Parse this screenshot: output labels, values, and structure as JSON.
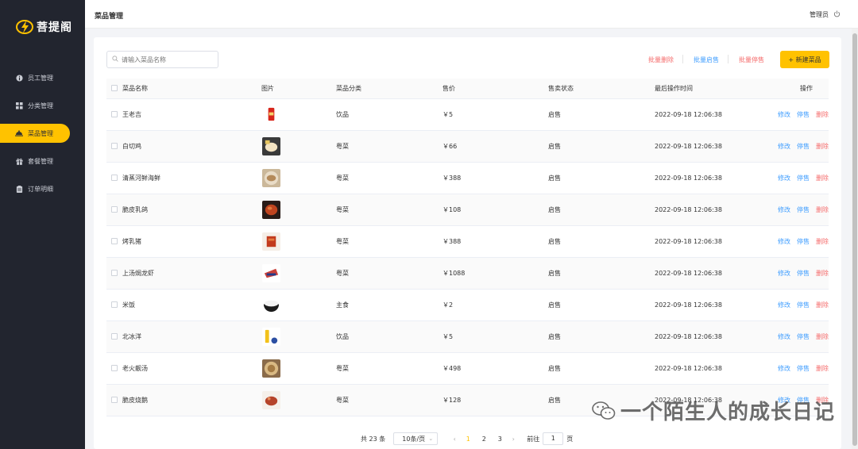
{
  "sidebar": {
    "brand": "菩提阁",
    "items": [
      {
        "label": "员工管理",
        "icon": "info-circle-icon",
        "active": false
      },
      {
        "label": "分类管理",
        "icon": "grid-icon",
        "active": false
      },
      {
        "label": "菜品管理",
        "icon": "dish-cover-icon",
        "active": true
      },
      {
        "label": "套餐管理",
        "icon": "gift-box-icon",
        "active": false
      },
      {
        "label": "订单明细",
        "icon": "clipboard-icon",
        "active": false
      }
    ]
  },
  "header": {
    "title": "菜品管理",
    "user": "管理员",
    "logout_icon": "power-icon"
  },
  "toolbar": {
    "search_placeholder": "请输入菜品名称",
    "batch_delete": "批量删除",
    "batch_enable": "批量启售",
    "batch_disable": "批量停售",
    "new_dish": "+ 新建菜品"
  },
  "table": {
    "headers": {
      "name": "菜品名称",
      "image": "图片",
      "category": "菜品分类",
      "price": "售价",
      "status": "售卖状态",
      "time": "最后操作时间",
      "ops": "操作"
    },
    "rows": [
      {
        "name": "王老吉",
        "image_icon": "red-can-icon",
        "category": "饮品",
        "price": "￥5",
        "status": "启售",
        "time": "2022-09-18 12:06:38",
        "edit": "修改",
        "toggle": "停售",
        "delete": "删除"
      },
      {
        "name": "白切鸡",
        "image_icon": "chicken-dish-icon",
        "category": "粤菜",
        "price": "￥66",
        "status": "启售",
        "time": "2022-09-18 12:06:38",
        "edit": "修改",
        "toggle": "停售",
        "delete": "删除"
      },
      {
        "name": "清蒸河鲜海鲜",
        "image_icon": "steamed-fish-icon",
        "category": "粤菜",
        "price": "￥388",
        "status": "启售",
        "time": "2022-09-18 12:06:38",
        "edit": "修改",
        "toggle": "停售",
        "delete": "删除"
      },
      {
        "name": "脆皮乳鸽",
        "image_icon": "roast-pigeon-icon",
        "category": "粤菜",
        "price": "￥108",
        "status": "启售",
        "time": "2022-09-18 12:06:38",
        "edit": "修改",
        "toggle": "停售",
        "delete": "删除"
      },
      {
        "name": "烤乳猪",
        "image_icon": "roast-pig-icon",
        "category": "粤菜",
        "price": "￥388",
        "status": "启售",
        "time": "2022-09-18 12:06:38",
        "edit": "修改",
        "toggle": "停售",
        "delete": "删除"
      },
      {
        "name": "上汤焗龙虾",
        "image_icon": "lobster-icon",
        "category": "粤菜",
        "price": "￥1088",
        "status": "启售",
        "time": "2022-09-18 12:06:38",
        "edit": "修改",
        "toggle": "停售",
        "delete": "删除"
      },
      {
        "name": "米饭",
        "image_icon": "rice-bowl-icon",
        "category": "主食",
        "price": "￥2",
        "status": "启售",
        "time": "2022-09-18 12:06:38",
        "edit": "修改",
        "toggle": "停售",
        "delete": "删除"
      },
      {
        "name": "北冰洋",
        "image_icon": "soda-bottle-icon",
        "category": "饮品",
        "price": "￥5",
        "status": "启售",
        "time": "2022-09-18 12:06:38",
        "edit": "修改",
        "toggle": "停售",
        "delete": "删除"
      },
      {
        "name": "老火靓汤",
        "image_icon": "soup-icon",
        "category": "粤菜",
        "price": "￥498",
        "status": "启售",
        "time": "2022-09-18 12:06:38",
        "edit": "修改",
        "toggle": "停售",
        "delete": "删除"
      },
      {
        "name": "脆皮烧鹅",
        "image_icon": "roast-goose-icon",
        "category": "粤菜",
        "price": "￥128",
        "status": "启售",
        "time": "2022-09-18 12:06:38",
        "edit": "修改",
        "toggle": "停售",
        "delete": "删除"
      }
    ]
  },
  "pagination": {
    "total": "共 23 条",
    "page_size": "10条/页",
    "pages": [
      "1",
      "2",
      "3"
    ],
    "current": "1",
    "goto_label": "前往",
    "goto_value": "1",
    "page_unit": "页"
  },
  "watermark": {
    "text": "一个陌生人的成长日记"
  },
  "colors": {
    "sidebar_bg": "#22252f",
    "accent": "#ffc200",
    "link_blue": "#409eff",
    "danger_red": "#f56c6c"
  }
}
